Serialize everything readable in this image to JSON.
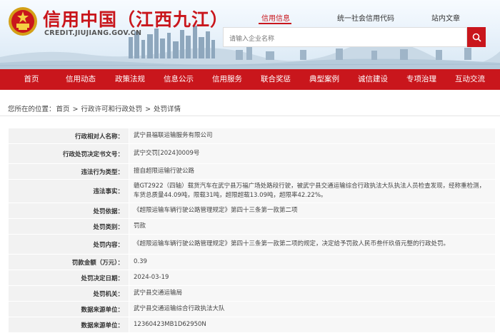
{
  "header": {
    "title": "信用中国（江西九江）",
    "domain": "CREDIT.JIUJIANG.GOV.CN"
  },
  "topnav": {
    "items": [
      {
        "label": "信用信息",
        "active": true
      },
      {
        "label": "统一社会信用代码",
        "active": false
      },
      {
        "label": "站内文章",
        "active": false
      }
    ]
  },
  "search": {
    "placeholder": "请输入企业名称"
  },
  "mainnav": {
    "items": [
      "首页",
      "信用动态",
      "政策法规",
      "信息公示",
      "信用服务",
      "联合奖惩",
      "典型案例",
      "诚信建设",
      "专项治理",
      "互动交流"
    ]
  },
  "breadcrumb": {
    "prefix": "您所在的位置：",
    "home": "首页",
    "sep": " > ",
    "section": "行政许可和行政处罚",
    "current": "处罚详情"
  },
  "detail": {
    "rows": [
      {
        "label": "行政相对人名称：",
        "value": "武宁县福联运输服务有限公司"
      },
      {
        "label": "行政处罚决定书文号：",
        "value": "武宁交罚[2024]0009号"
      },
      {
        "label": "违法行为类型：",
        "value": "擅自超限运输行驶公路"
      },
      {
        "label": "违法事实：",
        "value": "赣GT2922（四轴）载货汽车在武宁县万福广场处路段行驶，被武宁县交通运输综合行政执法大队执法人员检查发现，经称重检测，车货总质量44.09吨，限载31吨，超限超载13.09吨，超限率42.22%。"
      },
      {
        "label": "处罚依据：",
        "value": "《超限运输车辆行驶公路管理规定》第四十三条第一款第二项"
      },
      {
        "label": "处罚类别：",
        "value": "罚款"
      },
      {
        "label": "处罚内容：",
        "value": "《超限运输车辆行驶公路管理规定》第四十三条第一款第二项的规定，决定给予罚款人民币叁仟玖佰元整的行政处罚。"
      },
      {
        "label": "罚款金额（万元）：",
        "value": "0.39"
      },
      {
        "label": "处罚决定日期：",
        "value": "2024-03-19"
      },
      {
        "label": "处罚机关：",
        "value": "武宁县交通运输局"
      },
      {
        "label": "数据来源单位：",
        "value": "武宁县交通运输综合行政执法大队"
      },
      {
        "label": "数据来源单位：",
        "value": "12360423MB1D62950N"
      }
    ]
  },
  "colors": {
    "brand_red": "#c9161c"
  }
}
